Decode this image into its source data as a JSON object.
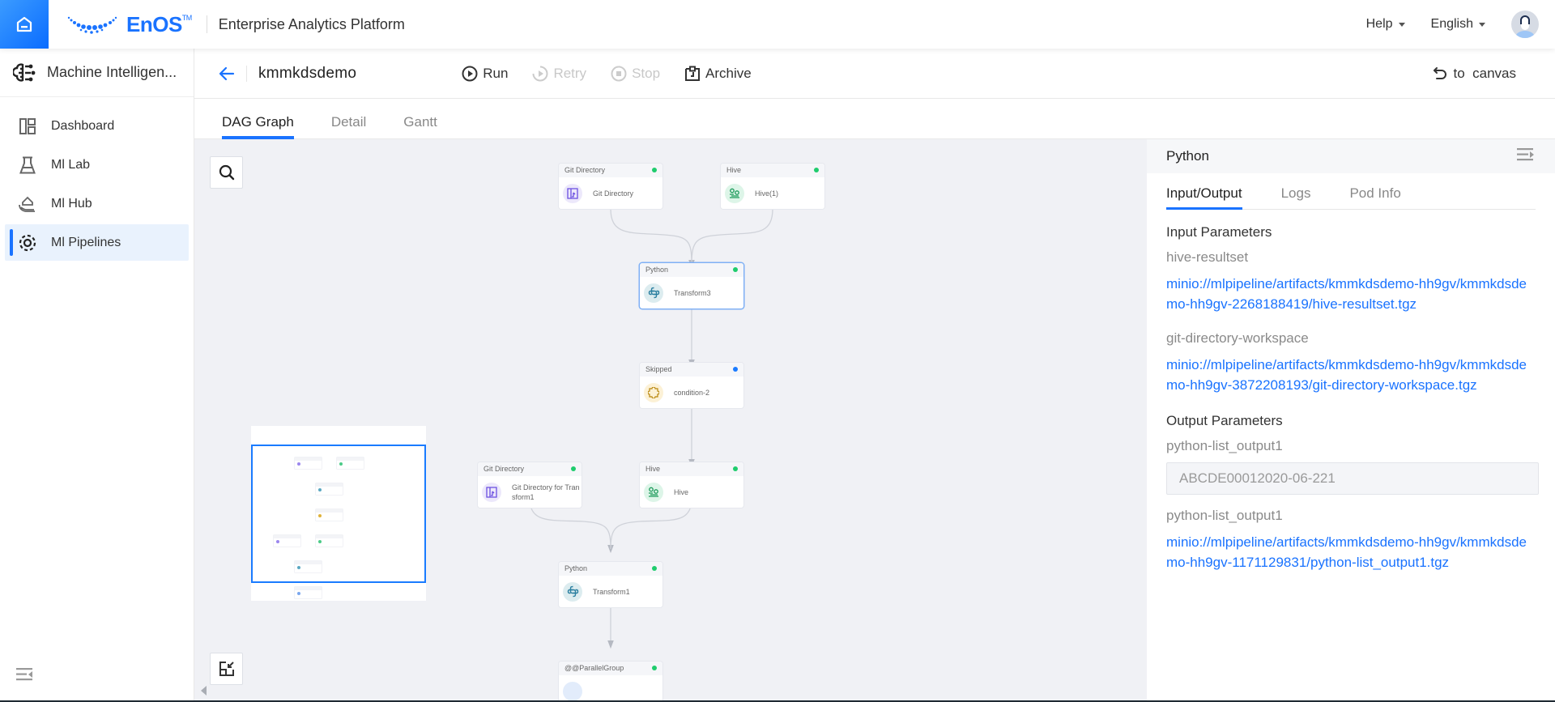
{
  "header": {
    "brand": "EnOS",
    "brand_tm": "TM",
    "platform_title": "Enterprise Analytics Platform",
    "help_label": "Help",
    "language_label": "English",
    "accent_color": "#1a73ff"
  },
  "sidebar": {
    "app_title": "Machine Intelligen...",
    "items": [
      {
        "label": "Dashboard",
        "icon": "dashboard-icon",
        "active": false
      },
      {
        "label": "Ml Lab",
        "icon": "flask-icon",
        "active": false
      },
      {
        "label": "Ml Hub",
        "icon": "hub-icon",
        "active": false
      },
      {
        "label": "Ml Pipelines",
        "icon": "pipeline-icon",
        "active": true
      }
    ]
  },
  "toolbar": {
    "pipeline_name": "kmmkdsdemo",
    "run_label": "Run",
    "retry_label": "Retry",
    "stop_label": "Stop",
    "archive_label": "Archive",
    "to_canvas_label": "to  canvas"
  },
  "tabs": [
    {
      "label": "DAG Graph",
      "active": true
    },
    {
      "label": "Detail",
      "active": false
    },
    {
      "label": "Gantt",
      "active": false
    }
  ],
  "dag": {
    "nodes": [
      {
        "id": "git1",
        "type": "Git Directory",
        "label": "Git Directory",
        "status": "success",
        "icon": "git-directory-icon"
      },
      {
        "id": "hive1",
        "type": "Hive",
        "label": "Hive(1)",
        "status": "success",
        "icon": "hive-icon"
      },
      {
        "id": "py3",
        "type": "Python",
        "label": "Transform3",
        "status": "success",
        "icon": "python-icon",
        "selected": true
      },
      {
        "id": "cond",
        "type": "Skipped",
        "label": "condition-2",
        "status": "skipped",
        "icon": "condition-icon"
      },
      {
        "id": "git2",
        "type": "Git Directory",
        "label": "Git Directory for Transform1",
        "status": "success",
        "icon": "git-directory-icon"
      },
      {
        "id": "hive2",
        "type": "Hive",
        "label": "Hive",
        "status": "success",
        "icon": "hive-icon"
      },
      {
        "id": "py1",
        "type": "Python",
        "label": "Transform1",
        "status": "success",
        "icon": "python-icon"
      },
      {
        "id": "pg",
        "type": "@@ParallelGroup",
        "label": "",
        "status": "success",
        "icon": "parallel-group-icon"
      }
    ],
    "status_colors": {
      "success": "#1fcc6d",
      "skipped": "#1a7bff"
    }
  },
  "panel": {
    "title": "Python",
    "tabs": [
      {
        "label": "Input/Output",
        "active": true
      },
      {
        "label": "Logs",
        "active": false
      },
      {
        "label": "Pod Info",
        "active": false
      }
    ],
    "input_title": "Input Parameters",
    "inputs": [
      {
        "name": "hive-resultset",
        "value": "minio://mlpipeline/artifacts/kmmkdsdemo-hh9gv/kmmkdsdemo-hh9gv-2268188419/hive-resultset.tgz"
      },
      {
        "name": "git-directory-workspace",
        "value": "minio://mlpipeline/artifacts/kmmkdsdemo-hh9gv/kmmkdsdemo-hh9gv-3872208193/git-directory-workspace.tgz"
      }
    ],
    "output_title": "Output Parameters",
    "outputs": [
      {
        "name": "python-list_output1",
        "value": "ABCDE00012020-06-221",
        "kind": "text"
      },
      {
        "name": "python-list_output1",
        "value": "minio://mlpipeline/artifacts/kmmkdsdemo-hh9gv/kmmkdsdemo-hh9gv-1171129831/python-list_output1.tgz",
        "kind": "link"
      }
    ]
  }
}
